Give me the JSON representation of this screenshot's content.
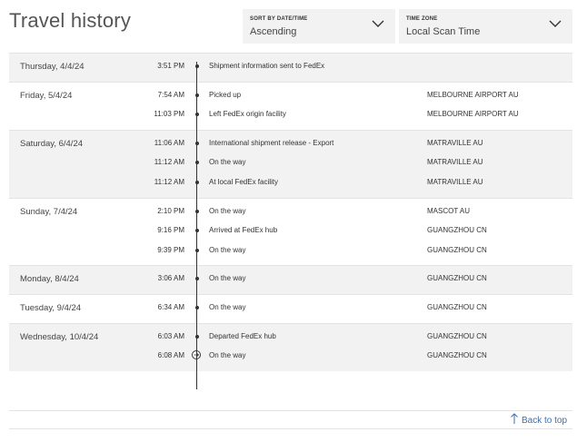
{
  "title": "Travel history",
  "sort": {
    "label": "SORT BY DATE/TIME",
    "value": "Ascending",
    "icon": "chevron-down-icon"
  },
  "timezone": {
    "label": "TIME ZONE",
    "value": "Local Scan Time",
    "icon": "chevron-down-icon"
  },
  "days": [
    {
      "date": "Thursday, 4/4/24",
      "shaded": true,
      "events": [
        {
          "time": "3:51 PM",
          "status": "Shipment information sent to FedEx",
          "location": ""
        }
      ]
    },
    {
      "date": "Friday, 5/4/24",
      "shaded": false,
      "events": [
        {
          "time": "7:54 AM",
          "status": "Picked up",
          "location": "MELBOURNE AIRPORT AU"
        },
        {
          "time": "11:03 PM",
          "status": "Left FedEx origin facility",
          "location": "MELBOURNE AIRPORT AU"
        }
      ]
    },
    {
      "date": "Saturday, 6/4/24",
      "shaded": true,
      "events": [
        {
          "time": "11:06 AM",
          "status": "International shipment release - Export",
          "location": "MATRAVILLE AU"
        },
        {
          "time": "11:12 AM",
          "status": "On the way",
          "location": "MATRAVILLE AU"
        },
        {
          "time": "11:12 AM",
          "status": "At local FedEx facility",
          "location": "MATRAVILLE AU"
        }
      ]
    },
    {
      "date": "Sunday, 7/4/24",
      "shaded": false,
      "events": [
        {
          "time": "2:10 PM",
          "status": "On the way",
          "location": "MASCOT AU"
        },
        {
          "time": "9:16 PM",
          "status": "Arrived at FedEx hub",
          "location": "GUANGZHOU CN"
        },
        {
          "time": "9:39 PM",
          "status": "On the way",
          "location": "GUANGZHOU CN"
        }
      ]
    },
    {
      "date": "Monday, 8/4/24",
      "shaded": true,
      "events": [
        {
          "time": "3:06 AM",
          "status": "On the way",
          "location": "GUANGZHOU CN"
        }
      ]
    },
    {
      "date": "Tuesday, 9/4/24",
      "shaded": false,
      "events": [
        {
          "time": "6:34 AM",
          "status": "On the way",
          "location": "GUANGZHOU CN"
        }
      ]
    },
    {
      "date": "Wednesday, 10/4/24",
      "shaded": true,
      "events": [
        {
          "time": "6:03 AM",
          "status": "Departed FedEx hub",
          "location": "GUANGZHOU CN"
        },
        {
          "time": "6:08 AM",
          "status": "On the way",
          "location": "GUANGZHOU CN",
          "current": true
        }
      ]
    }
  ],
  "back_to_top": {
    "label": "Back to top",
    "icon": "arrow-up-icon"
  }
}
